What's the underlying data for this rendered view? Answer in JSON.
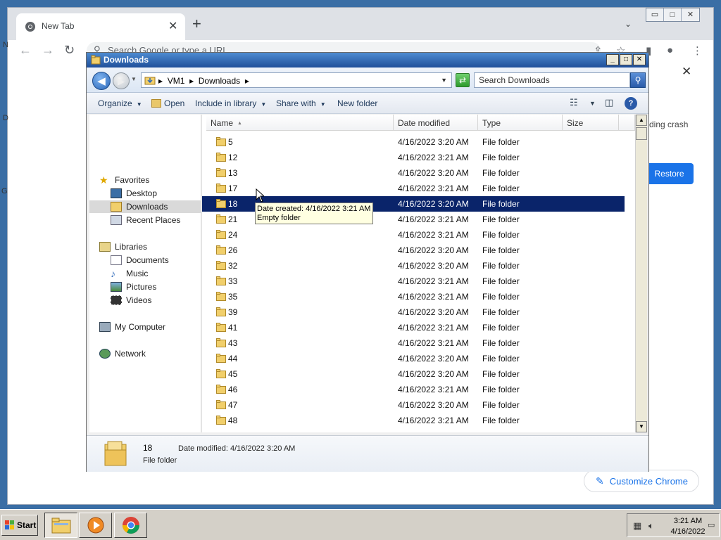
{
  "chrome": {
    "tab_title": "New Tab",
    "tab_close": "✕",
    "new_tab": "+",
    "tab_menu": "⌄",
    "omnibox_placeholder": "Search Google or type a URL",
    "crash_text": "ding crash",
    "restore_label": "Restore",
    "dialog_close": "✕",
    "customize_label": "Customize Chrome",
    "side_letters": [
      "N",
      "D",
      "G"
    ]
  },
  "window_controls": {
    "minimize": "▭",
    "maximize": "□",
    "close": "✕"
  },
  "explorer": {
    "title": "Downloads",
    "address": {
      "root": "VM1",
      "folder": "Downloads",
      "separator": "▸"
    },
    "search_placeholder": "Search Downloads",
    "commands": {
      "organize": "Organize",
      "open": "Open",
      "include_in_library": "Include in library",
      "share_with": "Share with",
      "new_folder": "New folder"
    },
    "nav": {
      "favorites": "Favorites",
      "desktop": "Desktop",
      "downloads": "Downloads",
      "recent_places": "Recent Places",
      "libraries": "Libraries",
      "documents": "Documents",
      "music": "Music",
      "pictures": "Pictures",
      "videos": "Videos",
      "my_computer": "My Computer",
      "network": "Network"
    },
    "columns": {
      "name": "Name",
      "date_modified": "Date modified",
      "type": "Type",
      "size": "Size"
    },
    "rows": [
      {
        "name": "5",
        "date": "4/16/2022 3:20 AM",
        "type": "File folder"
      },
      {
        "name": "12",
        "date": "4/16/2022 3:21 AM",
        "type": "File folder"
      },
      {
        "name": "13",
        "date": "4/16/2022 3:20 AM",
        "type": "File folder"
      },
      {
        "name": "17",
        "date": "4/16/2022 3:21 AM",
        "type": "File folder"
      },
      {
        "name": "18",
        "date": "4/16/2022 3:20 AM",
        "type": "File folder"
      },
      {
        "name": "21",
        "date": "4/16/2022 3:21 AM",
        "type": "File folder"
      },
      {
        "name": "24",
        "date": "4/16/2022 3:21 AM",
        "type": "File folder"
      },
      {
        "name": "26",
        "date": "4/16/2022 3:20 AM",
        "type": "File folder"
      },
      {
        "name": "32",
        "date": "4/16/2022 3:20 AM",
        "type": "File folder"
      },
      {
        "name": "33",
        "date": "4/16/2022 3:21 AM",
        "type": "File folder"
      },
      {
        "name": "35",
        "date": "4/16/2022 3:21 AM",
        "type": "File folder"
      },
      {
        "name": "39",
        "date": "4/16/2022 3:20 AM",
        "type": "File folder"
      },
      {
        "name": "41",
        "date": "4/16/2022 3:21 AM",
        "type": "File folder"
      },
      {
        "name": "43",
        "date": "4/16/2022 3:21 AM",
        "type": "File folder"
      },
      {
        "name": "44",
        "date": "4/16/2022 3:20 AM",
        "type": "File folder"
      },
      {
        "name": "45",
        "date": "4/16/2022 3:20 AM",
        "type": "File folder"
      },
      {
        "name": "46",
        "date": "4/16/2022 3:21 AM",
        "type": "File folder"
      },
      {
        "name": "47",
        "date": "4/16/2022 3:20 AM",
        "type": "File folder"
      },
      {
        "name": "48",
        "date": "4/16/2022 3:21 AM",
        "type": "File folder"
      }
    ],
    "selected_row": "18",
    "tooltip": {
      "line1": "Date created: 4/16/2022 3:21 AM",
      "line2": "Empty folder"
    },
    "details": {
      "name": "18",
      "modified": "Date modified:  4/16/2022 3:20 AM",
      "type": "File folder"
    }
  },
  "taskbar": {
    "start_label": "Start",
    "time": "3:21 AM",
    "date": "4/16/2022"
  },
  "colors": {
    "selection": "#0a246a",
    "chrome_accent": "#1a73e8",
    "titlebar": "#1f4f9a"
  }
}
